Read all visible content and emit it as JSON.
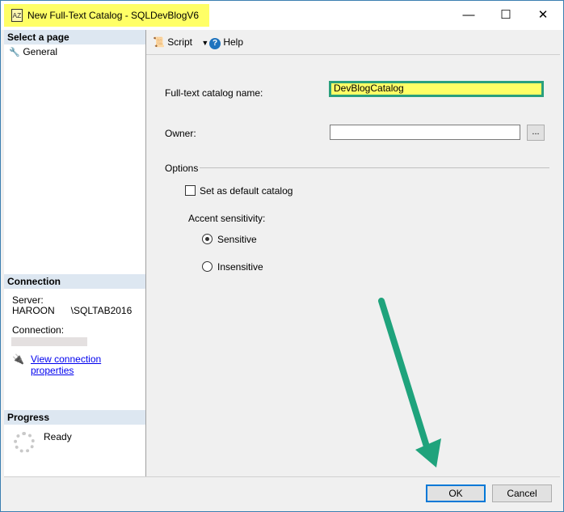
{
  "window": {
    "title": "New Full-Text Catalog - SQLDevBlogV6",
    "title_icon": "full-text-catalog-icon",
    "controls": [
      "minimize",
      "maximize",
      "close"
    ],
    "highlight_color": "#ffff66"
  },
  "sidebar": {
    "select_page_header": "Select a page",
    "items": [
      {
        "label": "General",
        "icon": "wrench-icon"
      }
    ],
    "connection_header": "Connection",
    "server_label": "Server:",
    "server_value": "HAROON      \\SQLTAB2016",
    "connection_label": "Connection:",
    "view_connection_link": "View connection properties",
    "progress_header": "Progress",
    "progress_status": "Ready"
  },
  "toolbar": {
    "script_label": "Script",
    "help_label": "Help"
  },
  "form": {
    "catalog_name_label": "Full-text catalog name:",
    "catalog_name_value": "DevBlogCatalog",
    "owner_label": "Owner:",
    "owner_value": "",
    "browse_button": "...",
    "options_label": "Options",
    "default_catalog_label": "Set as default catalog",
    "default_catalog_checked": false,
    "accent_label": "Accent sensitivity:",
    "accent_options": [
      {
        "label": "Sensitive",
        "selected": true
      },
      {
        "label": "Insensitive",
        "selected": false
      }
    ]
  },
  "buttons": {
    "ok": "OK",
    "cancel": "Cancel"
  },
  "colors": {
    "accent_border": "#2aa07e",
    "arrow": "#1fa37c",
    "section_header": "#dde7f1"
  }
}
